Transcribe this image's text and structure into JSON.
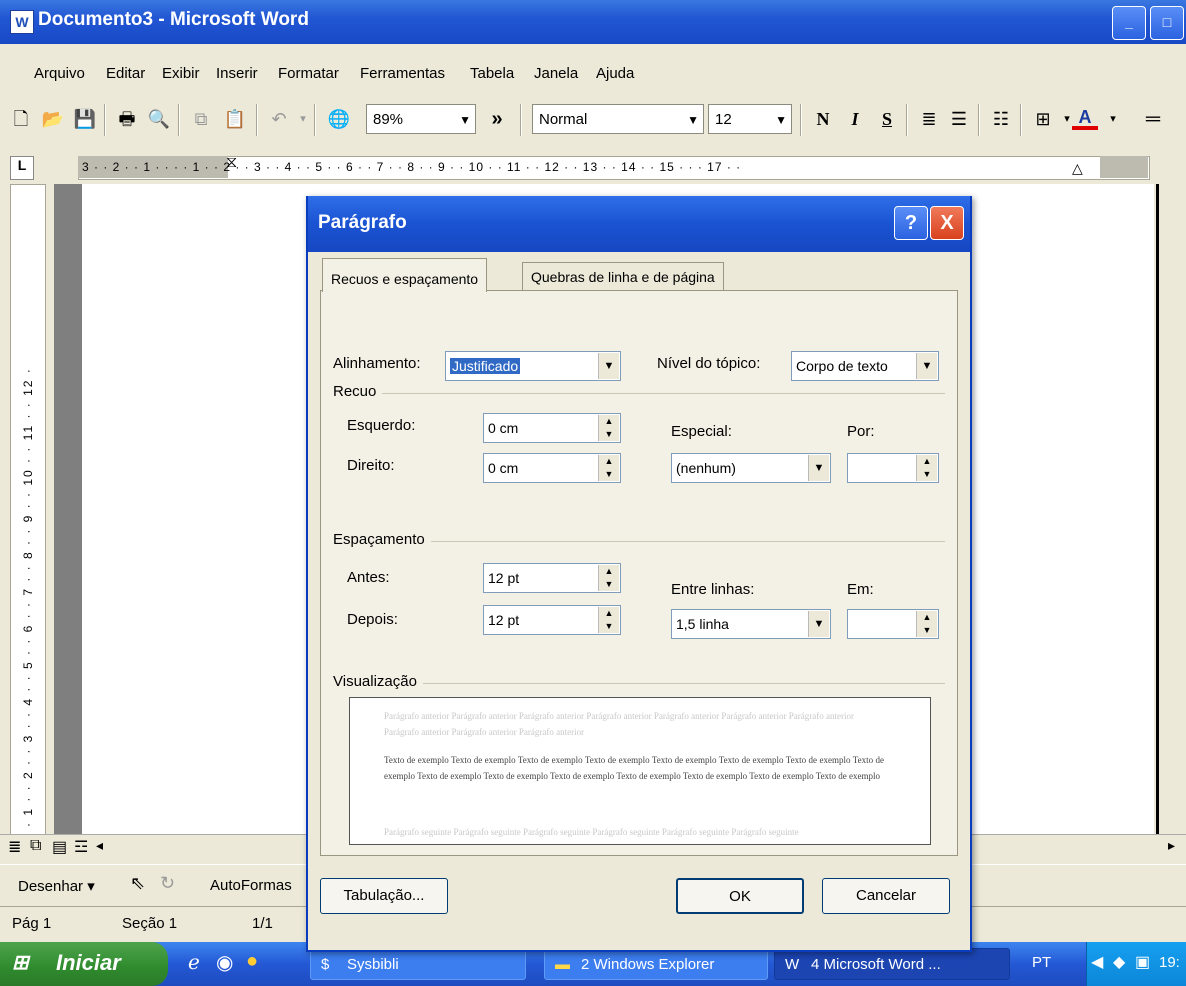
{
  "window": {
    "title": "Documento3 - Microsoft Word",
    "app_icon": "W",
    "minimize": "_",
    "maximize": "□"
  },
  "menu": [
    "Arquivo",
    "Editar",
    "Exibir",
    "Inserir",
    "Formatar",
    "Ferramentas",
    "Tabela",
    "Janela",
    "Ajuda"
  ],
  "toolbar": {
    "zoom": "89%",
    "more": "»",
    "style": "Normal",
    "font_size": "12",
    "bold": "N",
    "italic": "I",
    "underline": "S"
  },
  "ruler": {
    "corner": "L",
    "numbers": "3 · · 2 · · 1 · ·   · · 1 · · 2 · · 3 · · 4 · · 5 · · 6 · · 7 · · 8 · · 9 · · 10 · · 11 · · 12 · · 13 · · 14 · · 15 · ·   · 17 · ·",
    "vertical": "· 1 · · 2 · · 3 · · 4 · · 5 · · 6 · · 7 · · 8 · · 9 · · 10 · · 11 · · 12 ·"
  },
  "drawbar": {
    "draw_label": "Desenhar",
    "autoshapes_label": "AutoFormas"
  },
  "statusbar": {
    "page": "Pág 1",
    "section": "Seção 1",
    "pages": "1/1"
  },
  "taskbar": {
    "start_label": "Iniciar",
    "tasks": [
      "Sysbibli",
      "2 Windows Explorer",
      "4 Microsoft Word ..."
    ],
    "lang": "PT",
    "clock": "19:"
  },
  "dialog": {
    "title": "Parágrafo",
    "help": "?",
    "close": "X",
    "tabs": [
      "Recuos e espaçamento",
      "Quebras de linha e de página"
    ],
    "alignment_label": "Alinhamento:",
    "alignment_value": "Justificado",
    "outline_label": "Nível do tópico:",
    "outline_value": "Corpo de texto",
    "indent_group": "Recuo",
    "left_label": "Esquerdo:",
    "left_value": "0 cm",
    "right_label": "Direito:",
    "right_value": "0 cm",
    "special_label": "Especial:",
    "special_value": "(nenhum)",
    "by_label": "Por:",
    "by_value": "",
    "spacing_group": "Espaçamento",
    "before_label": "Antes:",
    "before_value": "12 pt",
    "after_label": "Depois:",
    "after_value": "12 pt",
    "line_label": "Entre linhas:",
    "line_value": "1,5 linha",
    "at_label": "Em:",
    "at_value": "",
    "preview_group": "Visualização",
    "preview_prev": "Parágrafo anterior Parágrafo anterior Parágrafo anterior Parágrafo anterior Parágrafo anterior Parágrafo anterior Parágrafo anterior Parágrafo anterior Parágrafo anterior Parágrafo anterior",
    "preview_sample": "Texto de exemplo Texto de exemplo Texto de exemplo Texto de exemplo Texto de exemplo Texto de exemplo Texto de exemplo Texto de exemplo Texto de exemplo Texto de exemplo Texto de exemplo Texto de exemplo Texto de exemplo Texto de exemplo Texto de exemplo",
    "preview_next": "Parágrafo seguinte Parágrafo seguinte Parágrafo seguinte Parágrafo seguinte Parágrafo seguinte Parágrafo seguinte",
    "tabs_button": "Tabulação...",
    "ok": "OK",
    "cancel": "Cancelar"
  }
}
